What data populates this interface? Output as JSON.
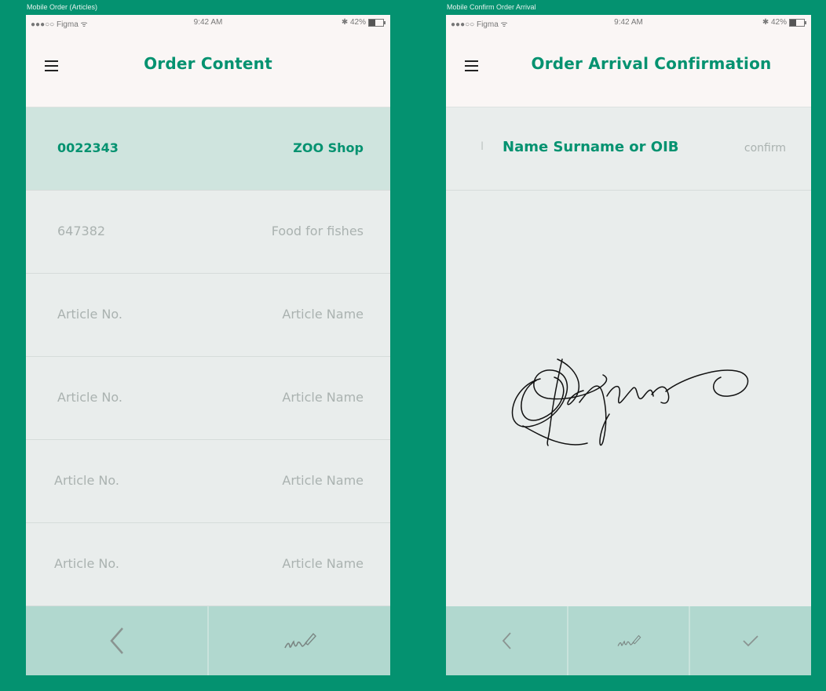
{
  "left_frame": {
    "label": "Mobile Order (Articles)",
    "status": {
      "carrier": "●●●○○ Figma ᯤ",
      "time": "9:42 AM",
      "battery": "✱ 42%"
    },
    "title": "Order Content",
    "order_row": {
      "number": "0022343",
      "shop": "ZOO Shop"
    },
    "rows": [
      {
        "left": "647382",
        "right": "Food for fishes"
      },
      {
        "left": "Article No.",
        "right": "Article Name"
      },
      {
        "left": "Article No.",
        "right": "Article Name"
      },
      {
        "left": "Article No.",
        "right": "Article Name"
      },
      {
        "left": "Article No.",
        "right": "Article Name"
      }
    ],
    "bottom_buttons": [
      "back-icon",
      "signature-icon"
    ]
  },
  "right_frame": {
    "label": "Mobile Confirm Order Arrival",
    "status": {
      "carrier": "●●●○○ Figma ᯤ",
      "time": "9:42 AM",
      "battery": "✱ 42%"
    },
    "title": "Order Arrival Confirmation",
    "field": {
      "cursor": "I",
      "placeholder": "Name Surname or OIB",
      "confirm": "confirm"
    },
    "bottom_buttons": [
      "back-icon",
      "signature-icon",
      "check-icon"
    ]
  },
  "colors": {
    "background": "#049270",
    "accent": "#049270",
    "active_row": "#cfe4de",
    "bottom_bar": "#b1d8cf",
    "header": "#faf6f5",
    "muted_text": "#aab2b0"
  }
}
